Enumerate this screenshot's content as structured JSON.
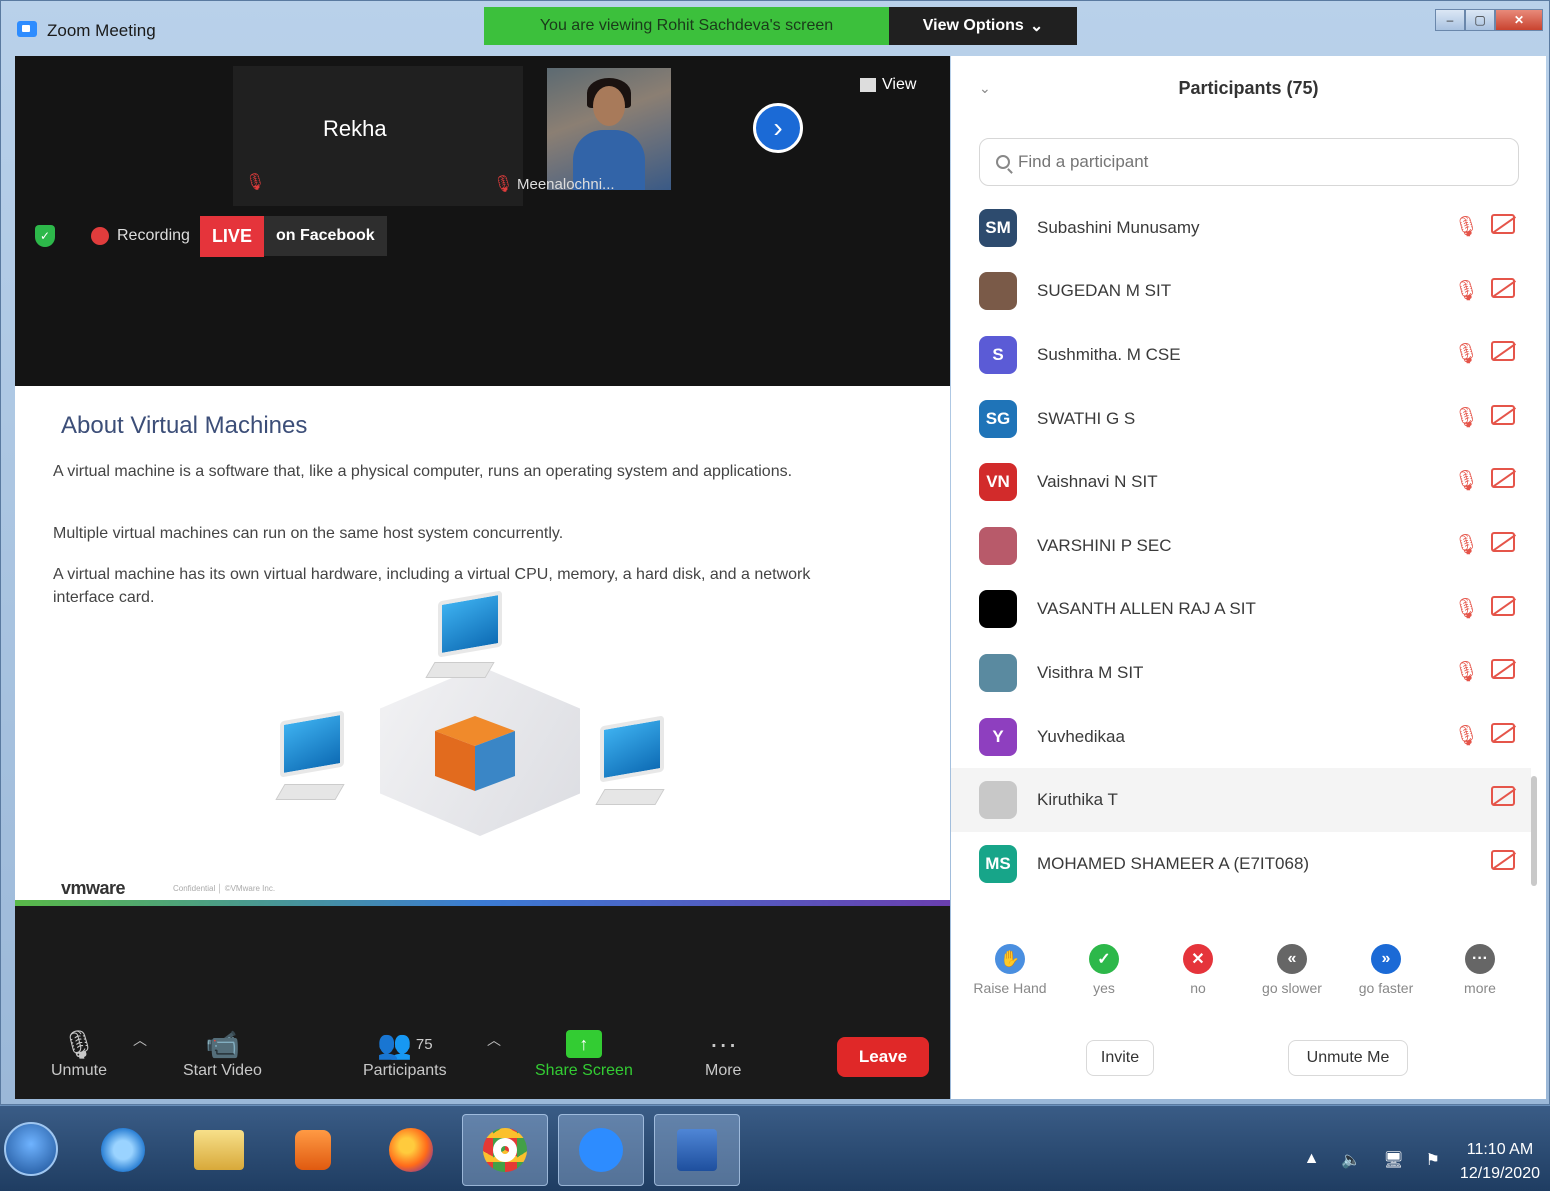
{
  "window": {
    "title": "Zoom Meeting",
    "banner": "You are viewing Rohit Sachdeva's screen",
    "view_options": "View Options",
    "caret": "⌄"
  },
  "videos": {
    "tile1_name": "Rekha",
    "tile2_name": "Meenalochni...",
    "view_label": "View"
  },
  "status": {
    "recording": "Recording",
    "live": "LIVE",
    "live_target": "on Facebook"
  },
  "slide": {
    "title": "About Virtual Machines",
    "p1": "A virtual machine is a software that, like a physical computer, runs an operating system and applications.",
    "p2": "Multiple virtual machines can run on the same host system concurrently.",
    "p3": "A virtual machine has its own virtual hardware, including a virtual CPU, memory, a hard disk, and a network interface card.",
    "logo": "vmware",
    "logo_small": "Confidential │ ©VMware Inc."
  },
  "toolbar": {
    "unmute": "Unmute",
    "start_video": "Start Video",
    "participants": "Participants",
    "participant_count": "75",
    "share_screen": "Share Screen",
    "more": "More",
    "leave": "Leave"
  },
  "panel": {
    "title": "Participants (75)",
    "search_placeholder": "Find a participant",
    "participants": [
      {
        "initials": "SM",
        "name": "Subashini Munusamy",
        "color": "#2d4b6e",
        "muted": true
      },
      {
        "initials": "",
        "name": "SUGEDAN M SIT",
        "color": "#7a5a48",
        "muted": true
      },
      {
        "initials": "S",
        "name": "Sushmitha. M CSE",
        "color": "#5b5bd6",
        "muted": true
      },
      {
        "initials": "SG",
        "name": "SWATHI G S",
        "color": "#1f74b8",
        "muted": true
      },
      {
        "initials": "VN",
        "name": "Vaishnavi N SIT",
        "color": "#d22b2b",
        "muted": true
      },
      {
        "initials": "",
        "name": "VARSHINI P SEC",
        "color": "#b85a6a",
        "muted": true
      },
      {
        "initials": "",
        "name": "VASANTH ALLEN RAJ A SIT",
        "color": "#000000",
        "muted": true
      },
      {
        "initials": "",
        "name": "Visithra M SIT",
        "color": "#5a8aa0",
        "muted": true
      },
      {
        "initials": "Y",
        "name": "Yuvhedikaa",
        "color": "#8e3fbf",
        "muted": true
      },
      {
        "initials": "",
        "name": "Kiruthika T",
        "color": "#c8c8c8",
        "muted": false
      },
      {
        "initials": "MS",
        "name": "MOHAMED SHAMEER A (E7IT068)",
        "color": "#17a589",
        "muted": false
      }
    ],
    "reactions": [
      {
        "label": "Raise Hand",
        "color": "#4a8fe0",
        "glyph": "✋"
      },
      {
        "label": "yes",
        "color": "#2db84a",
        "glyph": "✓"
      },
      {
        "label": "no",
        "color": "#e5343b",
        "glyph": "✕"
      },
      {
        "label": "go slower",
        "color": "#666666",
        "glyph": "«"
      },
      {
        "label": "go faster",
        "color": "#1b6ad6",
        "glyph": "»"
      },
      {
        "label": "more",
        "color": "#666666",
        "glyph": "···"
      }
    ],
    "invite": "Invite",
    "unmute_me": "Unmute Me"
  },
  "taskbar": {
    "time": "11:10 AM",
    "date": "12/19/2020"
  }
}
